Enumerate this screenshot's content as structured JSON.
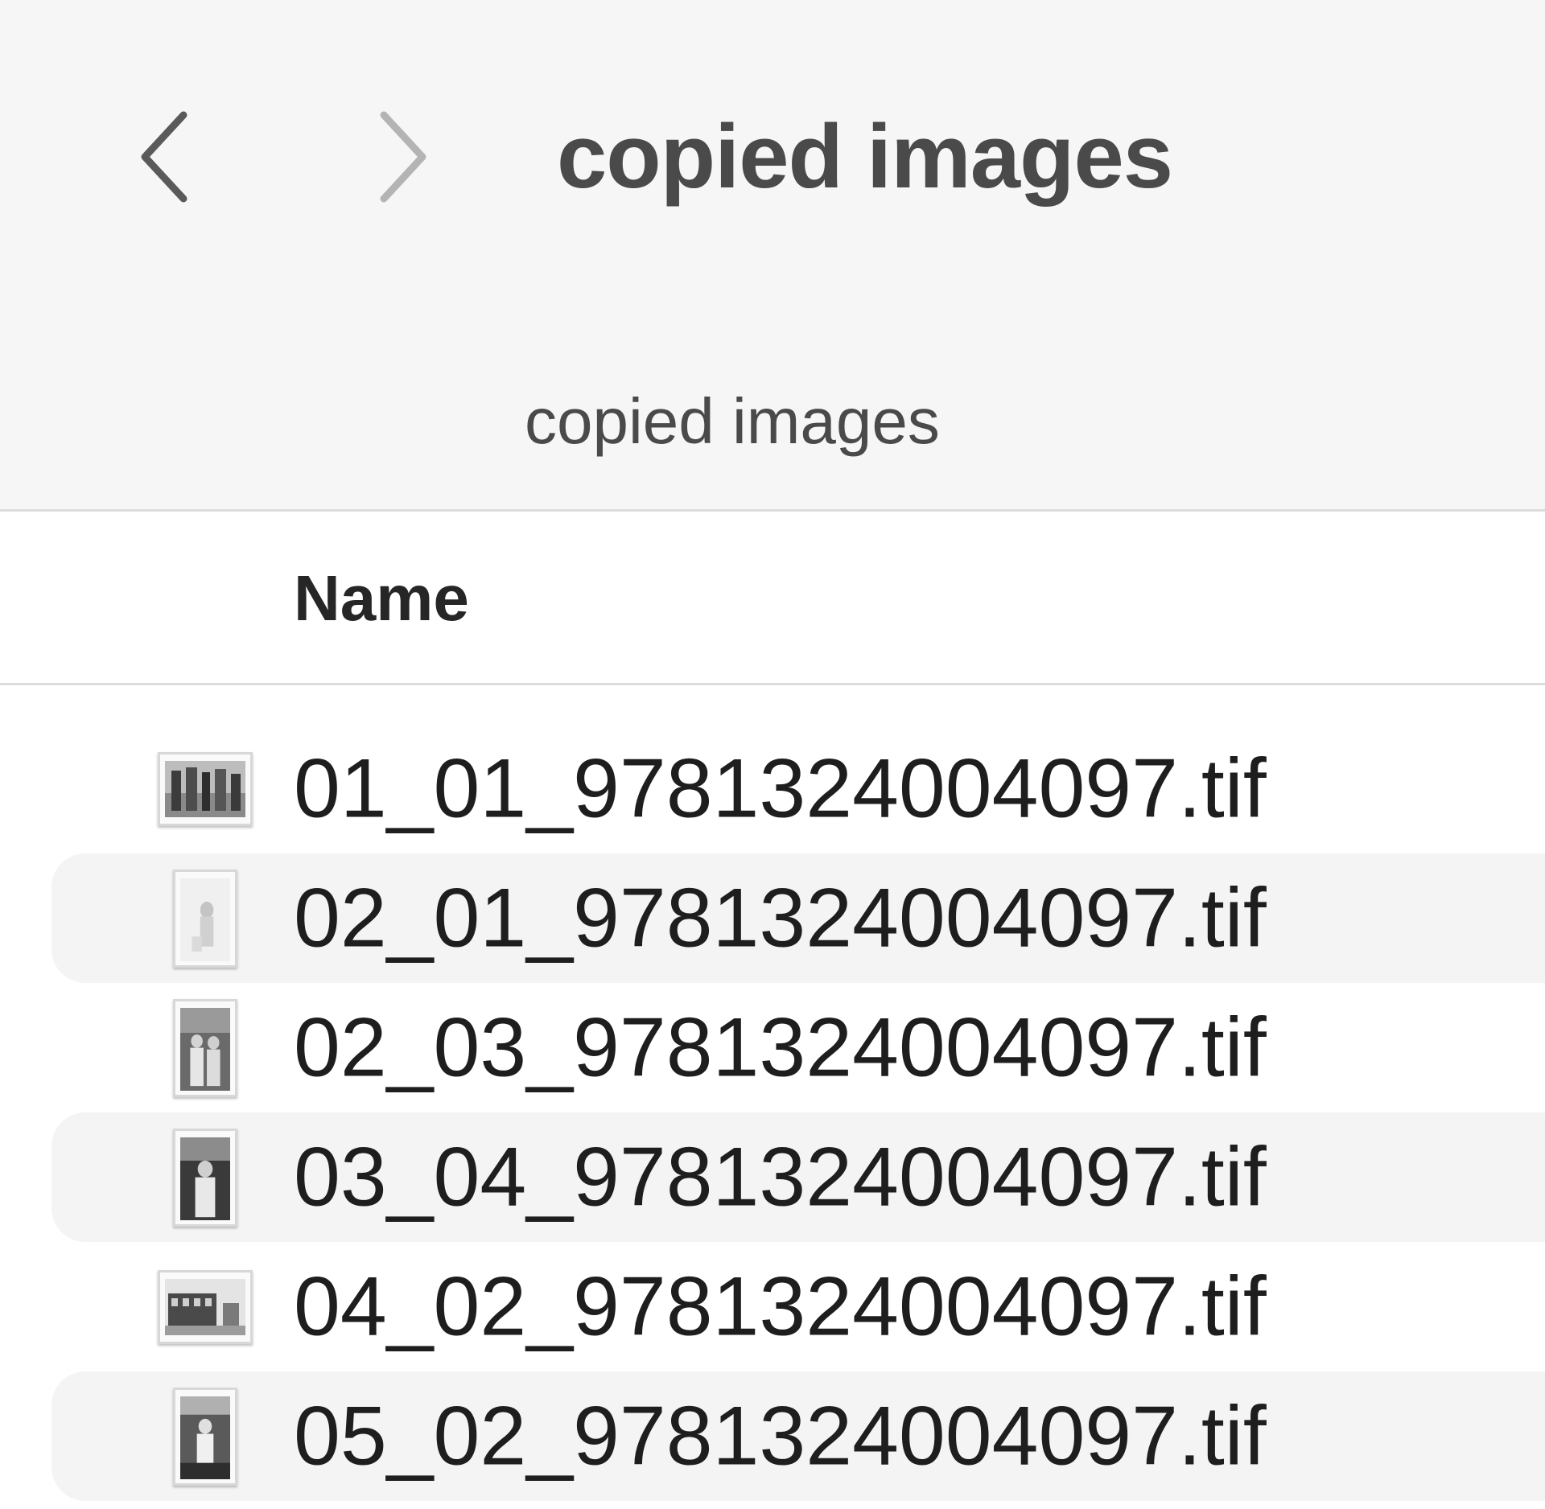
{
  "window": {
    "title": "copied images",
    "path_title": "copied images"
  },
  "navigation": {
    "back_icon": "chevron-left-icon",
    "forward_icon": "chevron-right-icon"
  },
  "columns": {
    "name": "Name"
  },
  "files": [
    {
      "name": "01_01_9781324004097.tif",
      "thumb": "landscape",
      "photo": "building-facade"
    },
    {
      "name": "02_01_9781324004097.tif",
      "thumb": "portrait",
      "photo": "light-figure"
    },
    {
      "name": "02_03_9781324004097.tif",
      "thumb": "portrait",
      "photo": "group-portrait"
    },
    {
      "name": "03_04_9781324004097.tif",
      "thumb": "portrait",
      "photo": "dark-portrait"
    },
    {
      "name": "04_02_9781324004097.tif",
      "thumb": "landscape",
      "photo": "building-street"
    },
    {
      "name": "05_02_9781324004097.tif",
      "thumb": "portrait",
      "photo": "people-outdoor"
    }
  ],
  "colors": {
    "toolbar_bg": "#f6f6f6",
    "row_alt_bg": "#f4f4f4",
    "text": "#1e1e1e",
    "separator": "#dcdcdc"
  }
}
